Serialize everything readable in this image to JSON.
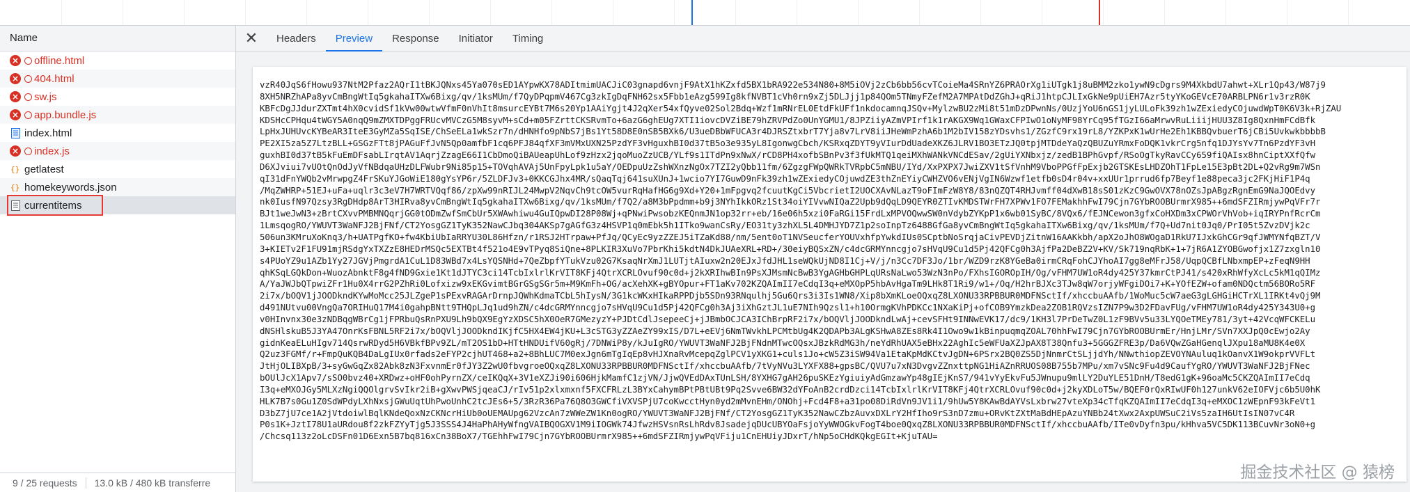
{
  "request_list": {
    "header": "Name",
    "items": [
      {
        "name": "offline.html",
        "status": "error",
        "icon": "error-icon"
      },
      {
        "name": "404.html",
        "status": "error",
        "icon": "error-icon"
      },
      {
        "name": "sw.js",
        "status": "error",
        "icon": "error-icon"
      },
      {
        "name": "app.bundle.js",
        "status": "error",
        "icon": "error-icon"
      },
      {
        "name": "index.html",
        "status": "ok",
        "icon": "document-icon"
      },
      {
        "name": "index.js",
        "status": "error",
        "icon": "error-icon"
      },
      {
        "name": "getlatest",
        "status": "ok",
        "icon": "fetch-icon"
      },
      {
        "name": "homekeywords.json",
        "status": "ok",
        "icon": "fetch-icon"
      },
      {
        "name": "currentitems",
        "status": "ok",
        "icon": "document-icon",
        "selected": true
      }
    ],
    "status_bar": {
      "requests": "9 / 25 requests",
      "transferred": "13.0 kB / 480 kB transferre"
    }
  },
  "detail_tabs": {
    "close_icon": "close-icon",
    "tabs": [
      "Headers",
      "Preview",
      "Response",
      "Initiator",
      "Timing"
    ],
    "active_tab": "Preview"
  },
  "preview": {
    "lines": [
      "vzR40JqS6fHowu937NtM2Pfaz2AQrI1tBKJQNxs45Ya070sED1AYpwKX78ADItmimUACJiC03gnapd6vnjF9AtX1hKZxfd5BX1bRA922e534N80+8M5iOVj2zCb6bb56cvTCoieMa4SRnYZ6PRAOrXg1iUTgk1j8uBMM2zko1ywN9cDgrs9M4XkbdU7ahwt+XLr1Qp43/W87j9",
      "8XH5NRZhAPa8yvCmBngWtIq5gkahaITXw6Bixg/qv/1ksMUm/f7QyDPqpmV467Cg3zkIgDqFNH62sx5Fbb1eAzg599Ig8kfNVBT1cVh0rn9xZj5DLJjj1p84QOm5TNmyFZefM2A7MPAtDdZGhJ+qRiJ1htpCJLIxGkNe9pUiEH7Azr5tyYKoGEVcE70ARBLPN6r1v3rzR0K",
      "KBFcDgJJdurZXTmt4hX0cvidSf1kVw00wtwVfmF0nVhIt8msurcEYBt7M6s20Yp1AAiYgjt4J2qXer54xfQyve02Sol2Bdq+Wzf1mRNrEL0EtdFkUFf1nkdocamnqJSQv+MylzwBU2zMi8t51mDzDPwnNs/0UzjYoU6nGS1jyLULoFk39zh1wZExiedyCOjuwdWpT0K6V3k+RjZAU",
      "KDSHcCPHqu4tWGY5A0nqQ9mZMXTDPggFRUcvMVCzG5M8syvM+sCd+m05FZrttCKSRvmTo+6azG6ghEUg7XTI1iovcDVZiBE79hZRVPdZo0UnYGMU1/8JPZiiyAZmVPIrf1k1rAKGX9Wq1GWaxCFPIwO1oNyMF98YrCq95fTGzI66aMrwvRuLiiijHUU3Z8Ig8QxnHmFCdBfk",
      "LpHxJUHUvcKYBeAR3IteE3GyMZa5SqISE/ChSeELa1wkSzr7n/dHNHfo9pNbS7jBs1Yt58D8E0nSB5BXk6/U3ueDBbWFUCA3r4DJRSZtxbrT7Yja8v7LrV8iiJHeWmPzhA6b1M2bIV158zYDsvhs1/ZGzfC9rx19rL8/YZKPxK1wUrHe2Eh1KBBQvbuerT6jCBi5UvkwkbbbbB",
      "PE2XI5za5Z7LtzBLL+GSGzFTt8jPAGuFfJvN5Qp0amfbF1cq6PFJ84qfXF3mVMxUXN25PzdYF3vHguxhBI0d37tB5o3e935yL8IgonwgCbch/KSRxqZDYT9yVIurDdUadeXKZ6JLRV1BO3ETzJQ0tpjMTDdeYaQzQBUZuYRmxFoDQK1vkrCrg5nfq1DJYsYv7Tn6PzdYF3vH",
      "guxhBI0d37tB5kFuEmDFsabLIrqtAV1AqrjZzagE66I1CbDmoQiBAUeapUhLof9zHzx2jqoMuoZzUCB/YLf9s1ITdPn9xNwX/rCD8PH4xofbSBnPv3f3fUkMTQ1qeiMXhWANkVNCdESav/2gUiYXNbxjz/zedB1BPhGvpf/RSoOgTkyRavCCy659fiQAIsx8hnCiptXXfQfw",
      "D6XJviui7vUOtQnOdJyVfNBdqaUHzDLFWubr9Ni85p15+TOVqhAVAj5UnFpyLpk1u5aY/OEDpuUzZshWXnzNgOx7TZI2yQbb11fm/6ZgzgFWpQWRkTVRpbC5mNBU/IYd/XxPXPX7JwiZXV1tSfVnhM9VboPPGfFpExjb2GTSKEsLHDZOhT1FpLe15E3pBt2DL+Q2vRg9m7WSn",
      "qI31dFnYWQb2vMrwpgZ4FrSKuYJGoWiE180gYsYP6r/5ZLDFJv3+0KKCGJhx4MR/sQaqTqj641suXUnJ+1wcio7YI7GuwD9nFk39zh1wZExiedyCOjuwdZE3thZnEYiyCWHZVO6vENjVgIN6Wzwf1etfb0sD4r04v+xxUUr1prrud6fp7Beyf1e88peca3jc2FKjHiF1P4q",
      "/MqZWHRP+51EJ+uFa+uqlr3c3eV7H7WRTVQqf86/zpXw99nRIJL24MwpV2NqvCh9tcOW5vurRqHafHG6g9Xd+Y20+1mFpgvq2fcuutKgCi5VbcrietI2UOCXAvNLazT9oFImFzW8Y8/83nQZQT4RHJvmff04dXwB18sS01zKzC9GwOVX78nOZsJpABgzRgnEmG9NaJQOEdvy",
      "nk0IusfN97Qzsy3RgDHdp8ArT3HIRva8yvCmBngWtIq5gkahaITXw6Bixg/qv/1ksMUm/f7Q2/a8M3bPpdmm+b9j3NYhIkkORz1St34oiYIVvwNIQaZ2Upb9dQqLD9QEYR0ZTIvKMDSTWrFH7XPWv1FO7FEMakhhFwI79Cjn7GYbROOBUrmrX985++6mdSFZIRmjywPqVFr7r",
      "BJt1weJwN3+zBrtCXvvPMBMNQqrjGG0tODmZwfSmCbUr5XWAwhiwu4GuIQpwDI28P08Wj+qPNwiPwsobzKEQnmJN1op32rr+eb/16e06h5xzi0FaRGi15FrdLxMPVOQwwSW0nVdybZYKpP1x6wb01SyBC/8VQx6/fEJNCewon3gfxCoHXDm3xCPWOrVhVob+iqIRYPnfRcrCm",
      "1LmsqogRO/YWUVT3WaNFJ2BjFNf/CT2YosgGZ1TyK352NawCJbq304AKSp7gAGfG3z4HSVP1q0mEbk5h1ITko9wanCsRy/EO31ty3zhXL5L4DMHJYD7Z1p2soInpTz6488GfGa8yvCmBngWtIq5gkahaITXw6Bixg/qv/1ksMUm/f7Q+Ud7nit0Jq0/PrI05t5ZvzDVjk2c",
      "506un3KMruXoKnq3/h+UATPgfKO+fw4KbiUbIaRRYU30L86Hfzn/r1RSJ2HTrpaw+PfJq/QCyEc9yzZZEJ5iTZaKd88/nm/5ent0oT1NVSeucferYOUVxhfpYwkdIUs0SCptbNoSrqjaCivPEVDjZitnW16AAKkbh/apX2oJhO8WOgaD1RkU7IJxkGhCGr9qfJWMYNfqBZT/V",
      "3+KIETv2F1FU91mjRSdgYxTXZzE8HEDrMSQc5EXTBt4f521o4E9vTPyq8SiQne+8PLKIR3XuVo7PbrKhi5kdtN4DkJUAeXRL+RD+/30eiyBQSxZN/c4dcGRMYnncgjo7sHVqU9Cu1d5Pj42QFCg0h3AjfPa2DeBZ2V+KV/Sk719nqRbK+1+7jR6A1ZYOBGwofjx1Z7zxgln10",
      "s4PUoYZ9u1AZb1Yy27JGVjPmgrdA1CuL1D83WBd7x4LsYQSNHd+7QeZbpfYTukVzu02G7KsaqNrXmJ1LUTjtAIuxw2n20EJxJfdJHL1seWQkUjND8I1Cj+V/j/n3Cc7DF3Jo/1br/WZD9rzK8YGeBa0irmCRqFohCJYhoAI7gg8eMFrJ58/UqpQCBfLNbxmpEP+zFeqN9HH",
      "qhKSqLGQkDon+WuozAbnktF8g4fND9Gxie1Kt1dJTYC3ci14TcbIxlrlKrVIT8KFj4QtrXCRLOvuf90c0d+j2kXRIhwBIn9PsXJMsmNcBwB3YgAGHbGHPLqURsNaLwo53WzN3nPo/FXhsIGOROpIH/Og/vFHM7UW1oR4dy425Y37kmrCtPJ41/s420xRhWfyXcLc5kM1qQIMz",
      "A/YaJWJbQTpwiZFr1Hu0X4rrG2PZhRi0Lofxizw9xEKGvimtBGrGSgSGr5m+M9KmFh+OG/acXehXK+gBYOpur+FT1aKv702KZQAImII7eCdqI3q+eMXOpP5hbAvHgaTm9LHk8T1Ri9/w1+/Oq/H2hrBJXc3TJw8qW7orjyWFgiDOi7+K+YOfEZW+ofam0NDQctm56BORo5RF",
      "2i7x/bOQV1jJOODkndKYwMoMcc25JLZgeP1sPExvRAGArDrnpJQWhKdmaTCbL5hIysN/3G1kcWKxHIkaRPPDjb5SDn93RNqulhj5Gu6Qrs3i3Is1WN8/Xip8bXmKLoeOQxqZ8LXONU33RPBBUR0MDFNSctIf/xhccbuAAfb/1WoMuc5cW7aeG3gLGHGiHCTrXL1IRKt4vQj9M",
      "d491NUtvu00VngQa7ORIHuQ17M4i0gahpBNtt9THQpLJq1ud9hZN/c4dcGRMYnncgjo7sHVqU9Cu1d5Pj42QFCg0h3Aj3iXhGztJL1uE7NIh9Qzsl1+h10OrmgKVhPDKCc1NXaKiPj+ofCOB9YmzkDea2ZOB1RQVzsIZN7P9w3D2FDavFUg/vFHM7UW1oR4dy425Y343U0+g",
      "v0HInvnx30e3zNDBqgWBrCg1jFPRbuQsRnPXU9Lh9bQX9EgYzXDSC5hX0OeR7GMezyzY+PJDtCdlJsepeeCj+jJBmbOCJCA3IChBrpRF2i7x/bOQVljJOODkndLwAj+cevSFHt9INNwEVK17/dc9/1KH3l7PrDeTwZ0L1zF9BVv5u33LYQOeTMEy781/3yt+42VcqWFCKELu",
      "dNSHlskuB5J3YA47OnrKsFBNL5RF2i7x/bOQVljJOODkndIKjfC5HX4EW4jKU+L3cSTG3yZZAeZY99xIS/D7L+eEVj6NmTWvkhLPCMtbUg4K2QDAPb3ALgKSHwA8ZEs8Rk4I1Owo9w1kBinpuqmqZOAL70hhFwI79Cjn7GYbROOBUrmEr/HnjLMr/SVn7XXJpQ0cEwjo2Ay",
      "gidnKeaELuHIgv714QsrwRDyd5H6VBkfBPv9ZL/mT2OS1bD+HTtHNDUifV60gRj/7DNWiP8y/kJuIgRO/YWUVT3WaNFJ2BjFNdnMTwcOQsxJBzkRdMG3h/neYdRhUAX5eBHx22AghIc5eWFUaXZJpAX8T38Qnfu3+5GGGZFRE3p/Da6VQwZGaHGenqlJXpu18aMU8K4e0X",
      "Q2uz3FGMf/r+FmpQuKQB4DaLgIUx0rfads2eFYP2cjhUT468+a2+8BhLUC7M0exJgn6mTgIqEp8vHJXnaRvMcepqZglPCV1yXKG1+culs1Jo+cW5Z3iSW94Va1EtaKpMdKCtvJgDN+6PSrx2BQ0ZS5DjNnmrCtSLjjdYh/NNwthiopZEVOYNAuluq1kOanvX1W9okprVVFLt",
      "JtHjOLIBXpB/3+syGwGqZx82Abk8zN3FxvnmEr0fJY3Z2wU0fbvgroeOQxqZ8LXONU33RPBBUR0MDFNSctIf/xhccbuAAfb/7tVyNVu3LYXFX88+gpsBC/QVU7u7xN3DvgvZZnxttpNG1HiAZnRRUOS08B755b7MPu/xm7vSNc9Fu4d9CaufYgRO/YWUVT3WaNFJ2BjFNec",
      "bOUlJcX1Apv7/sSO0bvz40+XRDwz+oHF0ohPyrnZX/ceIKQqX+3V1eXZJi90i606HjkMamfC1zjVN/JjwQVEdDAxTUnLSH/8YXHG7gAH26puSKEzYgiuiyAdGmzawYp48gIEjKnS7/941vYyEkvFu5JWnupu9mlLY2DuYLE51DnH/T8edG1gK+96oaMc5CKZQAImII7eCdq",
      "I3q+eMXOJGy5MLXzNgiQQOlgrvSvIkr2iB+gXwvPWSjqeaCJ/rIv51p2xlxmxnf5FXCFRLzL3BYxCahymBPtPBtUBt9Pq2Svve6BW32dYFoAnB2crdDzci14TcbIxlrlKrVIT8KFj4QtrXCRLOvuf90c0d+j2kyXDLoT5w/BQEF0rQxRIwUF0h127unkV62eIOFVjc6b5U0hK",
      "HLK7B7s0Gu1Z0SdWPdyLXhNxsjGWuUqtUhPwoUnhC2tcJEs6+5/3RzR36Pa76Q8O3GWCfiVXVSPjU7coKwcctHyn0yd2mMvnEHm/ONOhj+Fcd4F8+a31po08DiRdVn9JV1i1/9hUw5Y8KAwBdAYVsLxbrw27vteXp34cTfqKZQAImII7eCdqI3q+eMXOC1zWEpnF93kFeVt1",
      "D3bZ7jU7ce1A2jVtdoiwlBqlKNdeQoxNzCKNcrHiUb0oUEMAUpg62VzcAn7zWWeZW1Kn0ogRO/YWUVT3WaNFJ2BjFNf/CT2YosgGZ1TyK352NawCZbzAuvxDXLrY2HfIho9rS3nD7zmu+ORvKtZXtMaBdHEpAzuYNBb24tXwx2AxpUWSuC2iVs5zaIH6UtIsIN07vC4R",
      "P0s1K+JztI78U1aURdou8f2zkFZYyTjg5J3SSS4J4HaPhAHyWfngVAIBQOGXV1M9iIOGWk74JfwzHSVsnRsLhRdv8JsadejqDUcUBYOaFsjoYyWWOGkvFogT4boe0QxqZ8LXONU33RPBBUR0MDFNSctIf/xhccbuAAfb/ITe0vDyfn3pu/kHhva5VC5DK113BCuvNr3oN0+g",
      "/Chcsq113z2oLcDSFn01D6Exn5B7bq816xCn38BoX7/TGEhhFwI79Cjn7GYbROOBUrmrX985++6mdSFZIRmjywPqVFiju1CnEHUiyJDxrT/hNp5oCHdKQkgEGIt+KjuTAU="
    ]
  },
  "watermark": "掘金技术社区 @ 猿榜",
  "colors": {
    "accent": "#1a73e8",
    "error": "#d93025",
    "selection_outline": "#e53935"
  }
}
